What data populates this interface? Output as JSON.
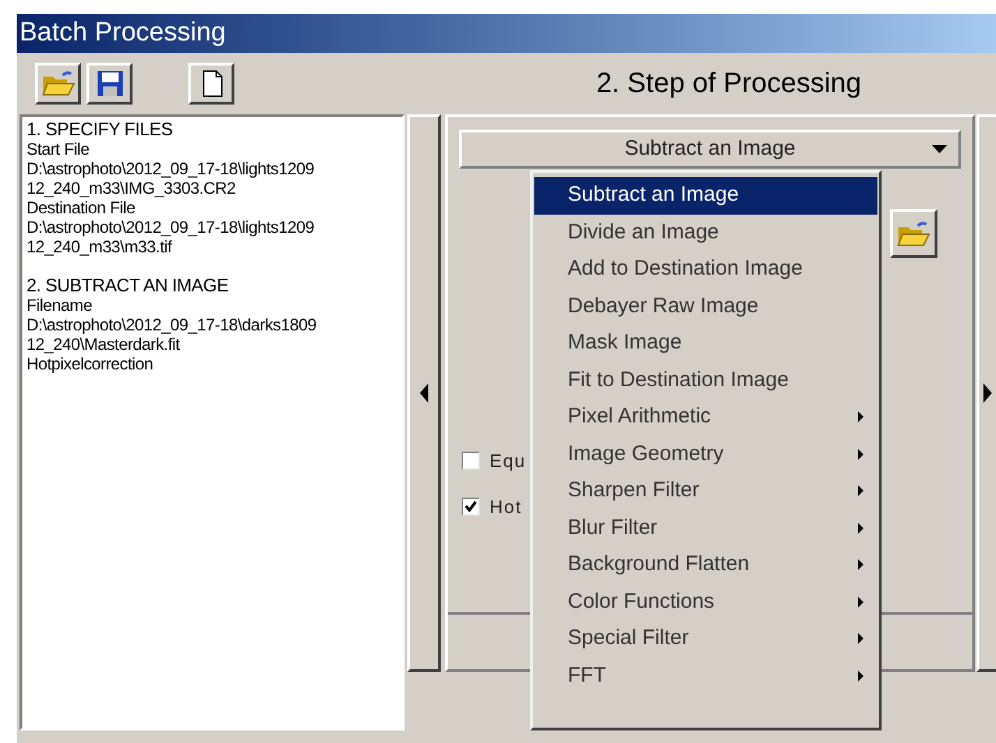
{
  "window": {
    "title": "Batch Processing"
  },
  "toolbar": [
    {
      "kind": "open"
    },
    {
      "kind": "save"
    },
    {
      "kind": "new"
    }
  ],
  "script_sections": [
    {
      "heading": "1. SPECIFY FILES",
      "lines": [
        "Start File",
        "D:\\astrophoto\\2012_09_17-18\\lights1209",
        "12_240_m33\\IMG_3303.CR2",
        "Destination File",
        "D:\\astrophoto\\2012_09_17-18\\lights1209",
        "12_240_m33\\m33.tif"
      ]
    },
    {
      "heading": "2. SUBTRACT AN IMAGE",
      "lines": [
        "Filename",
        "D:\\astrophoto\\2012_09_17-18\\darks1809",
        "12_240\\Masterdark.fit",
        "Hotpixelcorrection"
      ]
    }
  ],
  "step_heading": "2. Step of Processing",
  "step_dropdown": {
    "value": "Subtract an Image"
  },
  "checkboxes": [
    {
      "label": "Equ",
      "checked": false
    },
    {
      "label": "Hot",
      "checked": true
    }
  ],
  "menu": [
    {
      "label": "Subtract an Image",
      "selected": true,
      "has_submenu": false
    },
    {
      "label": "Divide an Image",
      "selected": false,
      "has_submenu": false
    },
    {
      "label": "Add to Destination Image",
      "selected": false,
      "has_submenu": false
    },
    {
      "label": "Debayer Raw Image",
      "selected": false,
      "has_submenu": false
    },
    {
      "label": "Mask Image",
      "selected": false,
      "has_submenu": false
    },
    {
      "label": "Fit to Destination Image",
      "selected": false,
      "has_submenu": false
    },
    {
      "label": "Pixel Arithmetic",
      "selected": false,
      "has_submenu": true
    },
    {
      "label": "Image Geometry",
      "selected": false,
      "has_submenu": true
    },
    {
      "label": "Sharpen Filter",
      "selected": false,
      "has_submenu": true
    },
    {
      "label": "Blur Filter",
      "selected": false,
      "has_submenu": true
    },
    {
      "label": "Background Flatten",
      "selected": false,
      "has_submenu": true
    },
    {
      "label": "Color Functions",
      "selected": false,
      "has_submenu": true
    },
    {
      "label": "Special Filter",
      "selected": false,
      "has_submenu": true
    },
    {
      "label": "FFT",
      "selected": false,
      "has_submenu": true
    }
  ]
}
